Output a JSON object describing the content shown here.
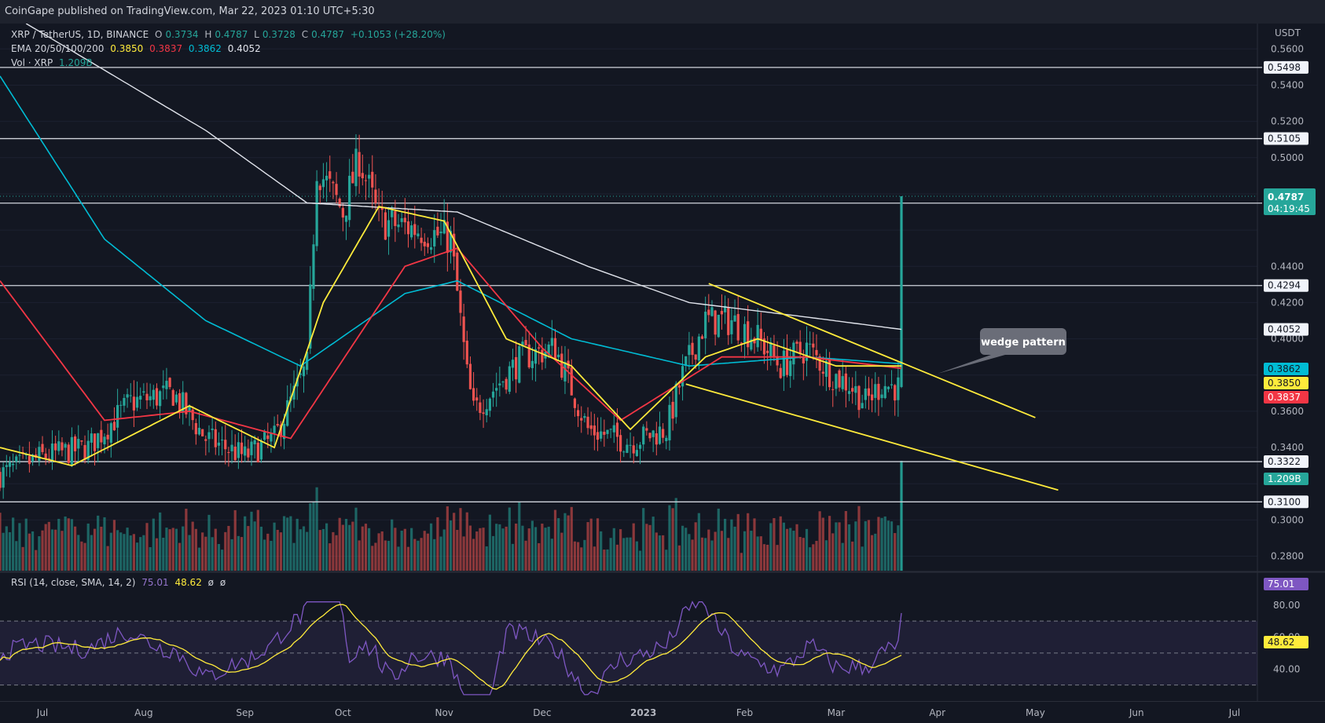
{
  "header": {
    "published": "CoinGape published on TradingView.com, Mar 22, 2023 01:10 UTC+5:30"
  },
  "legend": {
    "symbol": "XRP / TetherUS, 1D, BINANCE",
    "ohlc": {
      "o_label": "O",
      "o": "0.3734",
      "h_label": "H",
      "h": "0.4787",
      "l_label": "L",
      "l": "0.3728",
      "c_label": "C",
      "c": "0.4787",
      "change": "+0.1053 (+28.20%)"
    },
    "ema": {
      "label": "EMA 20/50/100/200",
      "e20": "0.3850",
      "e50": "0.3837",
      "e100": "0.3862",
      "e200": "0.4052"
    },
    "vol": {
      "label": "Vol · XRP",
      "value": "1.209B"
    },
    "rsi": {
      "label": "RSI (14, close, SMA, 14, 2)",
      "rsi": "75.01",
      "sma": "48.62",
      "x1": "ø",
      "x2": "ø"
    }
  },
  "axis": {
    "currency": "USDT",
    "price_ticks": [
      "0.5600",
      "0.5400",
      "0.5200",
      "0.5000",
      "0.4400",
      "0.4200",
      "0.4000",
      "0.3600",
      "0.3400",
      "0.3000",
      "0.2800"
    ],
    "rsi_ticks": [
      "80.00",
      "60.00",
      "40.00"
    ],
    "months": [
      "Jul",
      "Aug",
      "Sep",
      "Oct",
      "Nov",
      "Dec",
      "2023",
      "Feb",
      "Mar",
      "Apr",
      "May",
      "Jun",
      "Jul"
    ]
  },
  "badges": {
    "last_price": "0.4787",
    "countdown": "04:19:45",
    "ema200": "0.4052",
    "ema100": "0.3862",
    "ema20": "0.3850",
    "ema50": "0.3837",
    "volume": "1.209B",
    "rsi": "75.01",
    "rsi_sma": "48.62"
  },
  "annotation": {
    "text": "wedge pattern"
  },
  "chart_data": {
    "type": "candlestick",
    "title": "XRP / TetherUS, 1D, BINANCE",
    "y_unit": "USDT",
    "ylim": [
      0.272,
      0.574
    ],
    "x_range": [
      "2022-06-18",
      "2023-07-08"
    ],
    "horizontal_levels": [
      0.5498,
      0.5105,
      0.4749,
      0.4294,
      0.3322,
      0.31
    ],
    "wedge_upper": {
      "from": {
        "date": "2023-01-21",
        "price": 0.4305
      },
      "to": {
        "date": "2023-05-01",
        "price": 0.3565
      }
    },
    "wedge_lower": {
      "from": {
        "date": "2023-01-14",
        "price": 0.375
      },
      "to": {
        "date": "2023-05-08",
        "price": 0.3165
      }
    },
    "ohlc_anchor_closes": [
      [
        "2022-06-18",
        0.325
      ],
      [
        "2022-07-01",
        0.335
      ],
      [
        "2022-07-15",
        0.34
      ],
      [
        "2022-07-28",
        0.365
      ],
      [
        "2022-08-10",
        0.37
      ],
      [
        "2022-08-20",
        0.345
      ],
      [
        "2022-09-01",
        0.335
      ],
      [
        "2022-09-10",
        0.345
      ],
      [
        "2022-09-20",
        0.385
      ],
      [
        "2022-09-23",
        0.495
      ],
      [
        "2022-10-01",
        0.47
      ],
      [
        "2022-10-06",
        0.5
      ],
      [
        "2022-10-12",
        0.465
      ],
      [
        "2022-10-25",
        0.46
      ],
      [
        "2022-11-03",
        0.455
      ],
      [
        "2022-11-08",
        0.38
      ],
      [
        "2022-11-10",
        0.36
      ],
      [
        "2022-11-25",
        0.39
      ],
      [
        "2022-12-05",
        0.395
      ],
      [
        "2022-12-15",
        0.35
      ],
      [
        "2022-12-28",
        0.343
      ],
      [
        "2023-01-08",
        0.35
      ],
      [
        "2023-01-13",
        0.38
      ],
      [
        "2023-01-20",
        0.41
      ],
      [
        "2023-01-28",
        0.41
      ],
      [
        "2023-02-05",
        0.4
      ],
      [
        "2023-02-12",
        0.385
      ],
      [
        "2023-02-20",
        0.395
      ],
      [
        "2023-02-28",
        0.38
      ],
      [
        "2023-03-05",
        0.375
      ],
      [
        "2023-03-10",
        0.365
      ],
      [
        "2023-03-15",
        0.375
      ],
      [
        "2023-03-20",
        0.373
      ],
      [
        "2023-03-21",
        0.4787
      ]
    ],
    "ema_20": [
      [
        "2022-06-18",
        0.34
      ],
      [
        "2022-07-10",
        0.33
      ],
      [
        "2022-08-15",
        0.363
      ],
      [
        "2022-09-10",
        0.34
      ],
      [
        "2022-09-25",
        0.42
      ],
      [
        "2022-10-12",
        0.473
      ],
      [
        "2022-11-01",
        0.465
      ],
      [
        "2022-11-20",
        0.4
      ],
      [
        "2022-12-10",
        0.385
      ],
      [
        "2022-12-28",
        0.35
      ],
      [
        "2023-01-20",
        0.39
      ],
      [
        "2023-02-05",
        0.4
      ],
      [
        "2023-03-01",
        0.385
      ],
      [
        "2023-03-21",
        0.385
      ]
    ],
    "ema_50": [
      [
        "2022-06-18",
        0.432
      ],
      [
        "2022-07-20",
        0.355
      ],
      [
        "2022-08-15",
        0.36
      ],
      [
        "2022-09-15",
        0.345
      ],
      [
        "2022-10-20",
        0.44
      ],
      [
        "2022-11-05",
        0.45
      ],
      [
        "2022-12-01",
        0.395
      ],
      [
        "2022-12-25",
        0.355
      ],
      [
        "2023-01-25",
        0.39
      ],
      [
        "2023-02-20",
        0.39
      ],
      [
        "2023-03-21",
        0.3837
      ]
    ],
    "ema_100": [
      [
        "2022-06-18",
        0.545
      ],
      [
        "2022-07-20",
        0.455
      ],
      [
        "2022-08-20",
        0.41
      ],
      [
        "2022-09-18",
        0.385
      ],
      [
        "2022-10-20",
        0.425
      ],
      [
        "2022-11-05",
        0.432
      ],
      [
        "2022-12-10",
        0.4
      ],
      [
        "2023-01-15",
        0.385
      ],
      [
        "2023-02-20",
        0.39
      ],
      [
        "2023-03-21",
        0.3862
      ]
    ],
    "ema_200": [
      [
        "2022-06-26",
        0.574
      ],
      [
        "2022-08-20",
        0.515
      ],
      [
        "2022-09-20",
        0.475
      ],
      [
        "2022-11-05",
        0.47
      ],
      [
        "2022-12-15",
        0.44
      ],
      [
        "2023-01-15",
        0.42
      ],
      [
        "2023-02-20",
        0.412
      ],
      [
        "2023-03-21",
        0.4052
      ]
    ],
    "volume_last": "1.209B",
    "rsi": {
      "ylim": [
        20,
        100
      ],
      "levels": [
        70,
        50,
        30
      ],
      "last": 75.01,
      "sma_last": 48.62
    }
  }
}
